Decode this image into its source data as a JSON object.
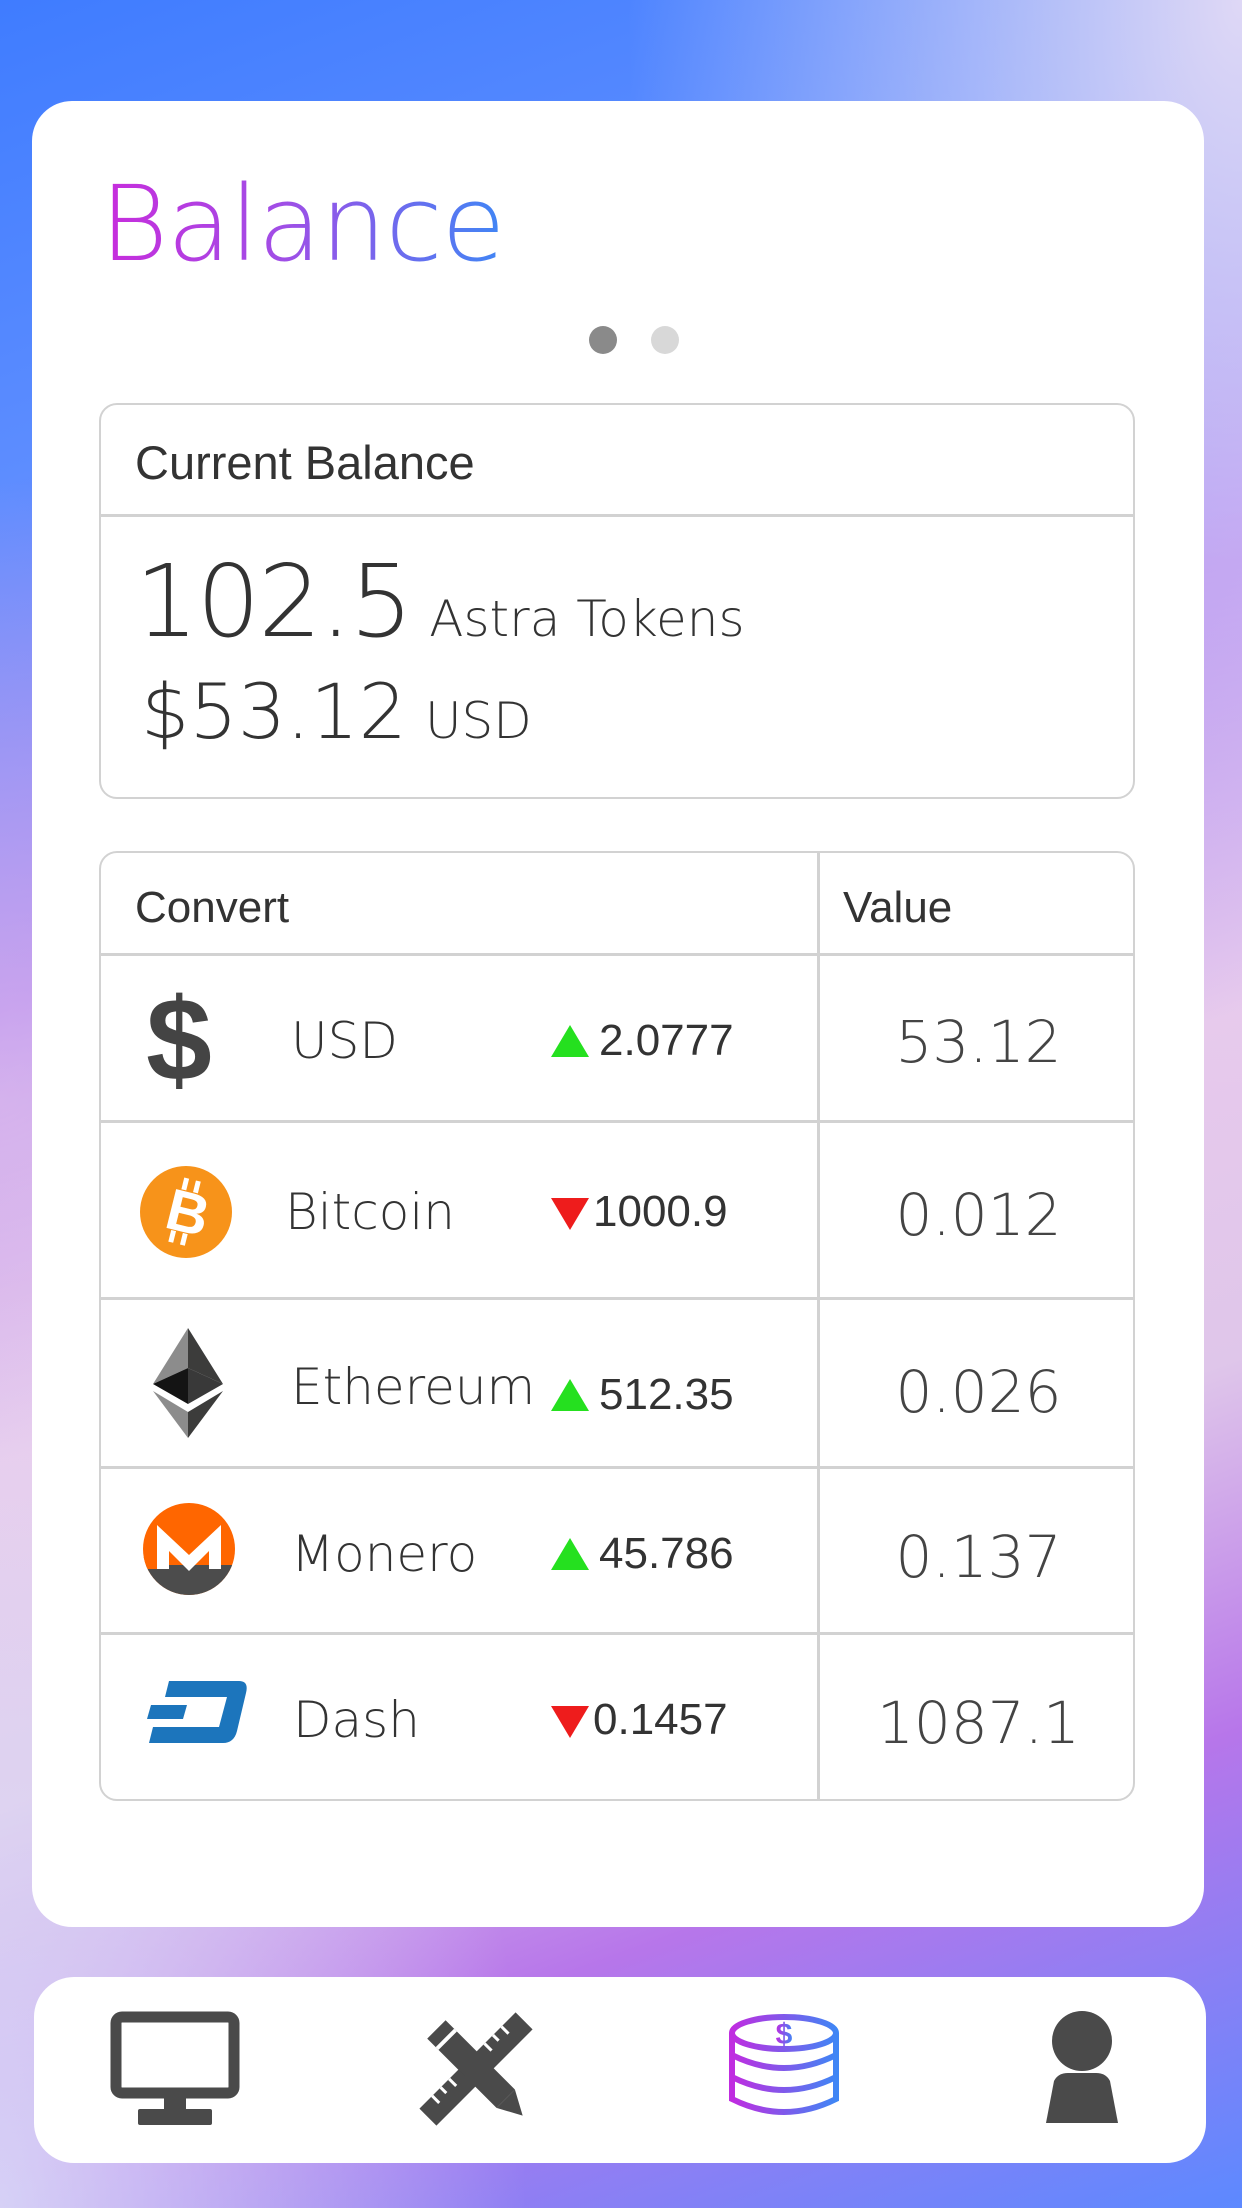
{
  "page": {
    "title": "Balance",
    "pager": {
      "count": 2,
      "active_index": 0
    }
  },
  "balance": {
    "header": "Current Balance",
    "tokens_amount": "102.5",
    "tokens_unit": "Astra Tokens",
    "usd_amount": "$53.12",
    "usd_unit": "USD"
  },
  "convert_table": {
    "headers": {
      "convert": "Convert",
      "value": "Value"
    },
    "rows": [
      {
        "icon": "dollar-icon",
        "name": "USD",
        "direction": "up",
        "change": "2.0777",
        "value": "53.12"
      },
      {
        "icon": "bitcoin-icon",
        "name": "Bitcoin",
        "direction": "down",
        "change": "1000.9",
        "value": "0.012"
      },
      {
        "icon": "ethereum-icon",
        "name": "Ethereum",
        "direction": "up",
        "change": "512.35",
        "value": "0.026"
      },
      {
        "icon": "monero-icon",
        "name": "Monero",
        "direction": "up",
        "change": "45.786",
        "value": "0.137"
      },
      {
        "icon": "dash-icon",
        "name": "Dash",
        "direction": "down",
        "change": "0.1457",
        "value": "1087.1"
      }
    ]
  },
  "nav": {
    "items": [
      {
        "icon": "monitor-icon",
        "active": false
      },
      {
        "icon": "pencil-ruler-icon",
        "active": false
      },
      {
        "icon": "coins-icon",
        "active": true
      },
      {
        "icon": "user-icon",
        "active": false
      }
    ]
  },
  "colors": {
    "up": "#25e01f",
    "down": "#ee1c1c",
    "accent_start": "#c82cdc",
    "accent_end": "#3f86f5"
  }
}
